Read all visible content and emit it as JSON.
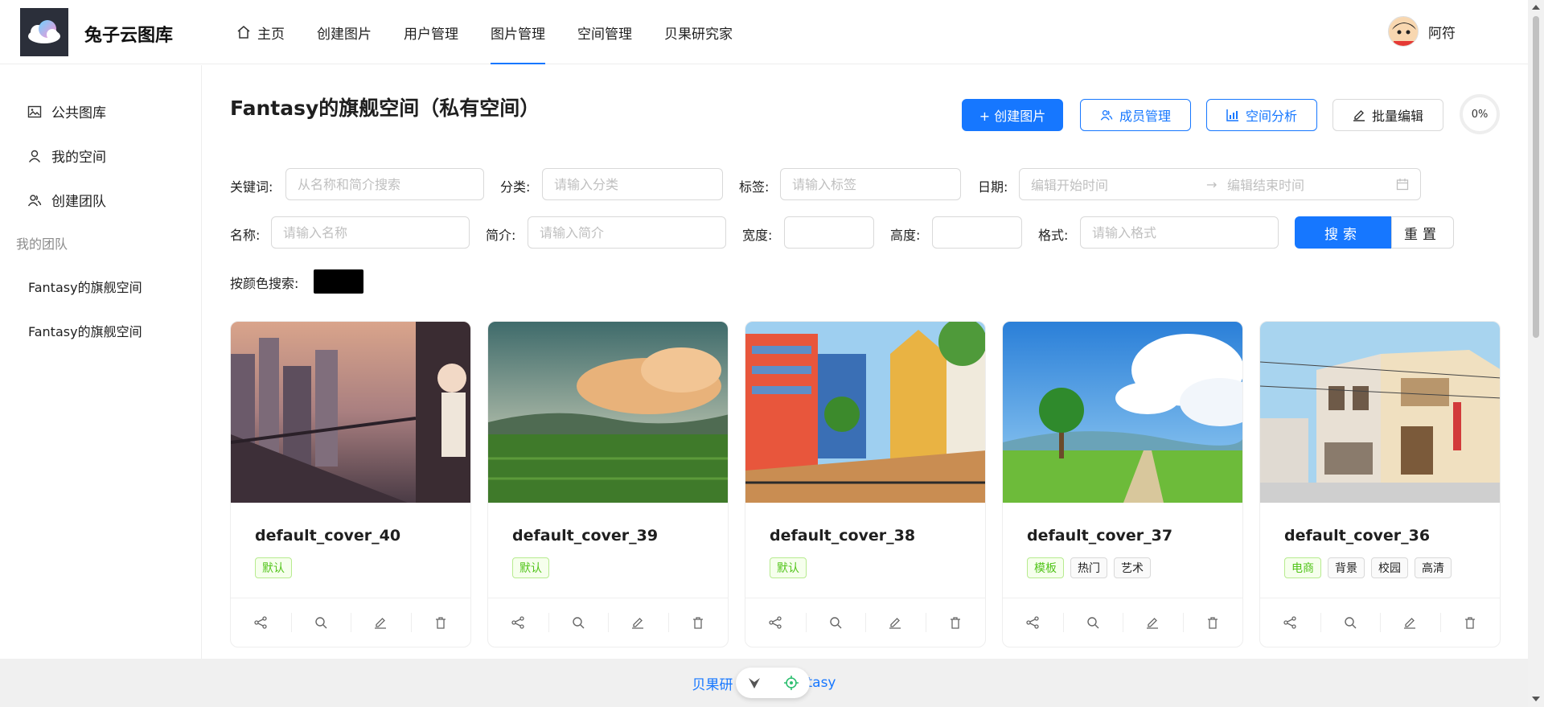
{
  "app": {
    "brand": "兔子云图库"
  },
  "nav": {
    "home": "主页",
    "create_picture": "创建图片",
    "user_manage": "用户管理",
    "picture_manage": "图片管理",
    "space_manage": "空间管理",
    "researcher": "贝果研究家"
  },
  "user": {
    "name": "阿符"
  },
  "sidebar": {
    "public_gallery": "公共图库",
    "my_space": "我的空间",
    "create_team": "创建团队",
    "my_teams_header": "我的团队",
    "teams": [
      "Fantasy的旗舰空间",
      "Fantasy的旗舰空间"
    ]
  },
  "page": {
    "title": "Fantasy的旗舰空间（私有空间）",
    "create_btn": "+ 创建图片",
    "members_btn": "成员管理",
    "analysis_btn": "空间分析",
    "batch_edit_btn": "批量编辑",
    "usage": "0%"
  },
  "filters": {
    "keyword_label": "关键词:",
    "keyword_placeholder": "从名称和简介搜索",
    "category_label": "分类:",
    "category_placeholder": "请输入分类",
    "tags_label": "标签:",
    "tags_placeholder": "请输入标签",
    "date_label": "日期:",
    "date_start": "编辑开始时间",
    "date_end": "编辑结束时间",
    "name_label": "名称:",
    "name_placeholder": "请输入名称",
    "intro_label": "简介:",
    "intro_placeholder": "请输入简介",
    "width_label": "宽度:",
    "height_label": "高度:",
    "format_label": "格式:",
    "format_placeholder": "请输入格式",
    "search_btn": "搜索",
    "reset_btn": "重置",
    "color_label": "按颜色搜索:",
    "color_value": "#000000"
  },
  "cards": [
    {
      "title": "default_cover_40",
      "tags": [
        {
          "text": "默认",
          "style": "green"
        }
      ]
    },
    {
      "title": "default_cover_39",
      "tags": [
        {
          "text": "默认",
          "style": "green"
        }
      ]
    },
    {
      "title": "default_cover_38",
      "tags": [
        {
          "text": "默认",
          "style": "green"
        }
      ]
    },
    {
      "title": "default_cover_37",
      "tags": [
        {
          "text": "模板",
          "style": "green"
        },
        {
          "text": "热门",
          "style": "default"
        },
        {
          "text": "艺术",
          "style": "default"
        }
      ]
    },
    {
      "title": "default_cover_36",
      "tags": [
        {
          "text": "电商",
          "style": "green"
        },
        {
          "text": "背景",
          "style": "default"
        },
        {
          "text": "校园",
          "style": "default"
        },
        {
          "text": "高清",
          "style": "default"
        }
      ]
    }
  ],
  "footer": {
    "left_text": "贝果研",
    "right_text": "tasy"
  },
  "colors": {
    "primary": "#1677ff",
    "tag_green": "#52c41a"
  }
}
